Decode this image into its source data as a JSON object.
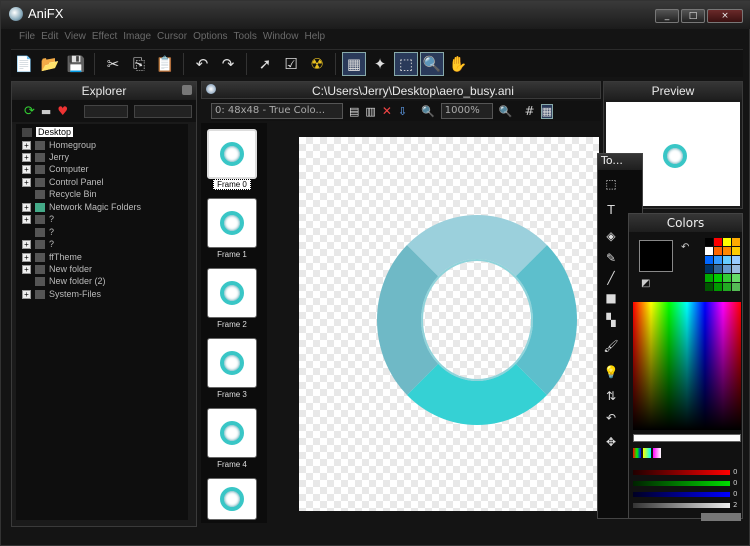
{
  "window": {
    "title": "AniFX",
    "btn_min": "_",
    "btn_max": "□",
    "btn_close": "×"
  },
  "menu": [
    "File",
    "Edit",
    "View",
    "Effect",
    "Image",
    "Cursor",
    "Options",
    "Tools",
    "Window",
    "Help"
  ],
  "toolbar": {
    "icons": [
      "new-file-icon",
      "open-folder-icon",
      "save-icon",
      "cut-icon",
      "copy-icon",
      "paste-icon",
      "undo-icon",
      "redo-icon",
      "pick-cursor-icon",
      "check-icon",
      "hazard-icon",
      "grid-view-icon",
      "animate-icon",
      "select-frame-icon",
      "zoom-icon",
      "test-cursor-icon"
    ]
  },
  "explorer": {
    "title": "Explorer",
    "selected": "Desktop",
    "items": [
      "Homegroup",
      "Jerry",
      "Computer",
      "Control Panel",
      "Recycle Bin",
      "Network Magic Folders",
      "?",
      "?",
      "?",
      "ffTheme",
      "New folder",
      "New folder (2)",
      "System-Files"
    ]
  },
  "document": {
    "path": "C:\\Users\\Jerry\\Desktop\\aero_busy.ani",
    "frame_format": "0: 48x48 - True Colo...",
    "zoom": "1000%"
  },
  "frames": [
    "Frame 0",
    "Frame 1",
    "Frame 2",
    "Frame 3",
    "Frame 4"
  ],
  "preview": {
    "title": "Preview"
  },
  "tools": {
    "title": "To..."
  },
  "colors": {
    "title": "Colors",
    "primary": "#000000",
    "secondary": "#ffffff",
    "red_value": "0",
    "green_value": "0",
    "blue_value": "0",
    "alpha_value": "2"
  }
}
